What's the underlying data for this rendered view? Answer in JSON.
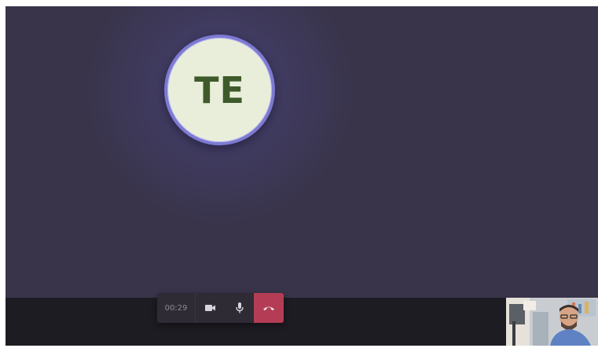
{
  "call": {
    "avatar_initials": "TE",
    "timer": "00:29"
  },
  "controls": {
    "camera_icon": "video-camera-icon",
    "mic_icon": "microphone-icon",
    "hangup_icon": "phone-hangup-icon"
  },
  "colors": {
    "stage_background": "#39344a",
    "bottom_bar": "#1e1c23",
    "avatar_fill": "#e9eedb",
    "avatar_ring": "#7d7ad3",
    "initials": "#3f5a2a",
    "hangup": "#b43c55"
  },
  "self_view": {
    "description_icon": "self-video-preview"
  }
}
